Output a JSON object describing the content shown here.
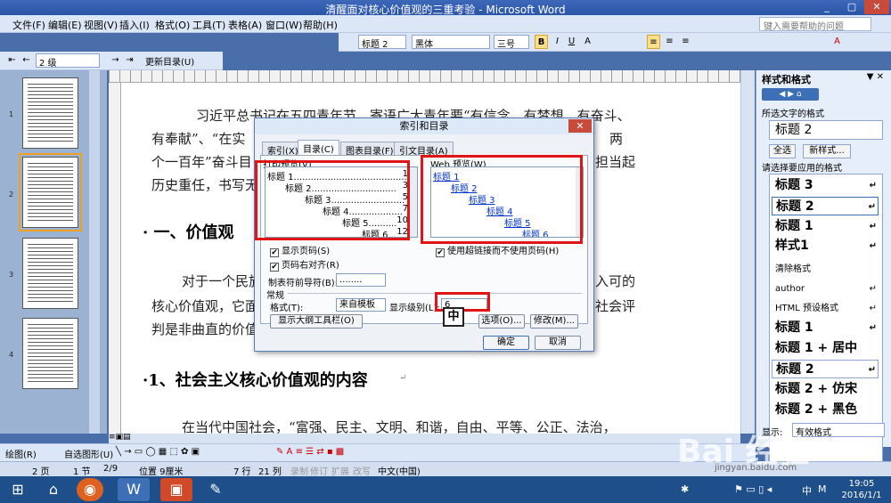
{
  "window": {
    "title": "清醒面对核心价值观的三重考验 - Microsoft Word",
    "min": "_",
    "max": "▢",
    "close": "✕"
  },
  "menu": {
    "items": [
      "文件(F)",
      "编辑(E)",
      "视图(V)",
      "插入(I)",
      "格式(O)",
      "工具(T)",
      "表格(A)",
      "窗口(W)",
      "帮助(H)"
    ],
    "help_placeholder": "键入需要帮助的问题"
  },
  "format_toolbar": {
    "style": "标题 2",
    "font": "黑体",
    "size": "三号",
    "bold": "B",
    "italic": "I",
    "underline": "U",
    "char_a": "A"
  },
  "outline_toolbar": {
    "level": "2 级",
    "update_toc": "更新目录(U)"
  },
  "thumbnails": {
    "page_numbers": [
      "1",
      "2",
      "3",
      "4"
    ]
  },
  "document": {
    "lines": [
      "习近平总书记在五四青年节，寄语广大青年要“有信念、有梦想、有奋斗、",
      "有奉献”、“在实",
      "个一百年”奋斗目",
      "历史重任，书写无"
    ],
    "right_fragments": [
      "两",
      "担当起"
    ],
    "heading1": "·  一、价值观",
    "para2": [
      "对于一个民族",
      "核心价值观，它面",
      "判是非曲直的价值"
    ],
    "para2_right": [
      "入可的",
      "社会评"
    ],
    "heading2": "·1、社会主义核心价值观的内容",
    "heading2_mark": "↵",
    "para3": "在当代中国社会，“富强、民主、文明、和谐，自由、平等、公正、法治，"
  },
  "dialog": {
    "title": "索引和目录",
    "close": "✕",
    "tabs": [
      "索引(X)",
      "目录(C)",
      "图表目录(F)",
      "引文目录(A)"
    ],
    "print_label": "打印预览(V)",
    "print_preview": [
      {
        "text": "标题 1",
        "page": "1"
      },
      {
        "text": "标题 2",
        "page": "3"
      },
      {
        "text": "标题 3",
        "page": "5"
      },
      {
        "text": "标题 4",
        "page": "7"
      },
      {
        "text": "标题 5",
        "page": "10"
      },
      {
        "text": "标题 6",
        "page": "12"
      }
    ],
    "web_label": "Web 预览(W)",
    "web_preview": [
      "标题 1",
      "标题 2",
      "标题 3",
      "标题 4",
      "标题 5",
      "标题 6"
    ],
    "show_page_numbers": "显示页码(S)",
    "right_align_page_numbers": "页码右对齐(R)",
    "tab_leader_label": "制表符前导符(B):",
    "tab_leader_value": "........",
    "use_hyperlinks": "使用超链接而不使用页码(H)",
    "general_label": "常规",
    "formats_label": "格式(T):",
    "formats_value": "来自模板",
    "show_levels_label": "显示级别(L):",
    "show_levels_value": "6",
    "show_outline_toolbar": "显示大纲工具栏(O)",
    "options_button": "选项(O)...",
    "modify_button": "修改(M)...",
    "ok_button": "确定",
    "cancel_button": "取消",
    "annotation": "中"
  },
  "task_pane": {
    "title": "样式和格式",
    "selected_label": "所选文字的格式",
    "selected_value": "标题 2",
    "select_all": "全选",
    "new_style": "新样式...",
    "apply_label": "请选择要应用的格式",
    "styles": [
      {
        "name": "标题 3",
        "mark": "↵"
      },
      {
        "name": "标题 2",
        "mark": "↵"
      },
      {
        "name": "标题  1",
        "mark": "↵"
      },
      {
        "name": "   样式1",
        "mark": "↵"
      },
      {
        "name": "清除格式",
        "mark": ""
      },
      {
        "name": "author",
        "mark": "↵"
      },
      {
        "name": "HTML 预设格式",
        "mark": "↵"
      },
      {
        "name": "标题  1",
        "mark": "↵"
      },
      {
        "name": "标题 1 + 居中",
        "mark": ""
      },
      {
        "name": "标题 2",
        "mark": "↵"
      },
      {
        "name": "标题 2 + 仿宋",
        "mark": ""
      },
      {
        "name": "标题 2 + 黑色",
        "mark": ""
      }
    ],
    "show_label": "显示:",
    "show_value": "有效格式"
  },
  "drawing_toolbar": {
    "draw": "绘图(R)",
    "autoshapes": "自选图形(U)"
  },
  "status_bar": {
    "page": "2 页",
    "section": "1 节",
    "pos": "2/9",
    "at": "位置 9厘米",
    "line": "7 行",
    "col": "21 列",
    "rec": "录制",
    "trk": "修订",
    "ext": "扩展",
    "ovr": "改写",
    "lang": "中文(中国)"
  },
  "taskbar": {
    "time": "19:05",
    "date": "2016/1/1",
    "ime": "中",
    "ime2": "M"
  },
  "watermark": {
    "logo": "Bai  经验",
    "url": "jingyan.baidu.com"
  }
}
